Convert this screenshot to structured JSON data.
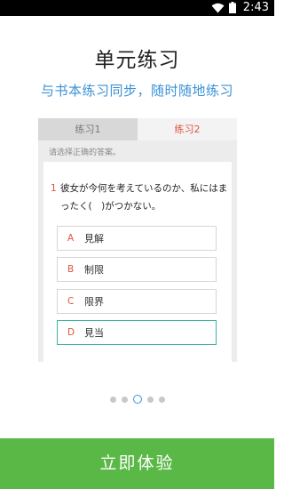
{
  "status_bar": {
    "time": "2:43",
    "icons": [
      "wifi-icon",
      "battery-icon"
    ]
  },
  "title": "单元练习",
  "subtitle": "与书本练习同步，随时随地练习",
  "preview": {
    "tabs": [
      {
        "label": "练习1",
        "active": false
      },
      {
        "label": "练习2",
        "active": true
      }
    ],
    "instruction": "请选择正确的答案。",
    "question": {
      "number": "1",
      "text": "彼女が今何を考えているのか、私にはまったく(　)がつかない。"
    },
    "options": [
      {
        "letter": "A",
        "text": "見解",
        "selected": false
      },
      {
        "letter": "B",
        "text": "制限",
        "selected": false
      },
      {
        "letter": "C",
        "text": "限界",
        "selected": false
      },
      {
        "letter": "D",
        "text": "見当",
        "selected": true
      }
    ]
  },
  "pager": {
    "count": 5,
    "active_index": 2
  },
  "cta_label": "立即体验",
  "colors": {
    "accent_blue": "#3a92d6",
    "accent_red": "#e0533f",
    "cta_green": "#5ab847",
    "selected_border": "#3cb4a0"
  }
}
